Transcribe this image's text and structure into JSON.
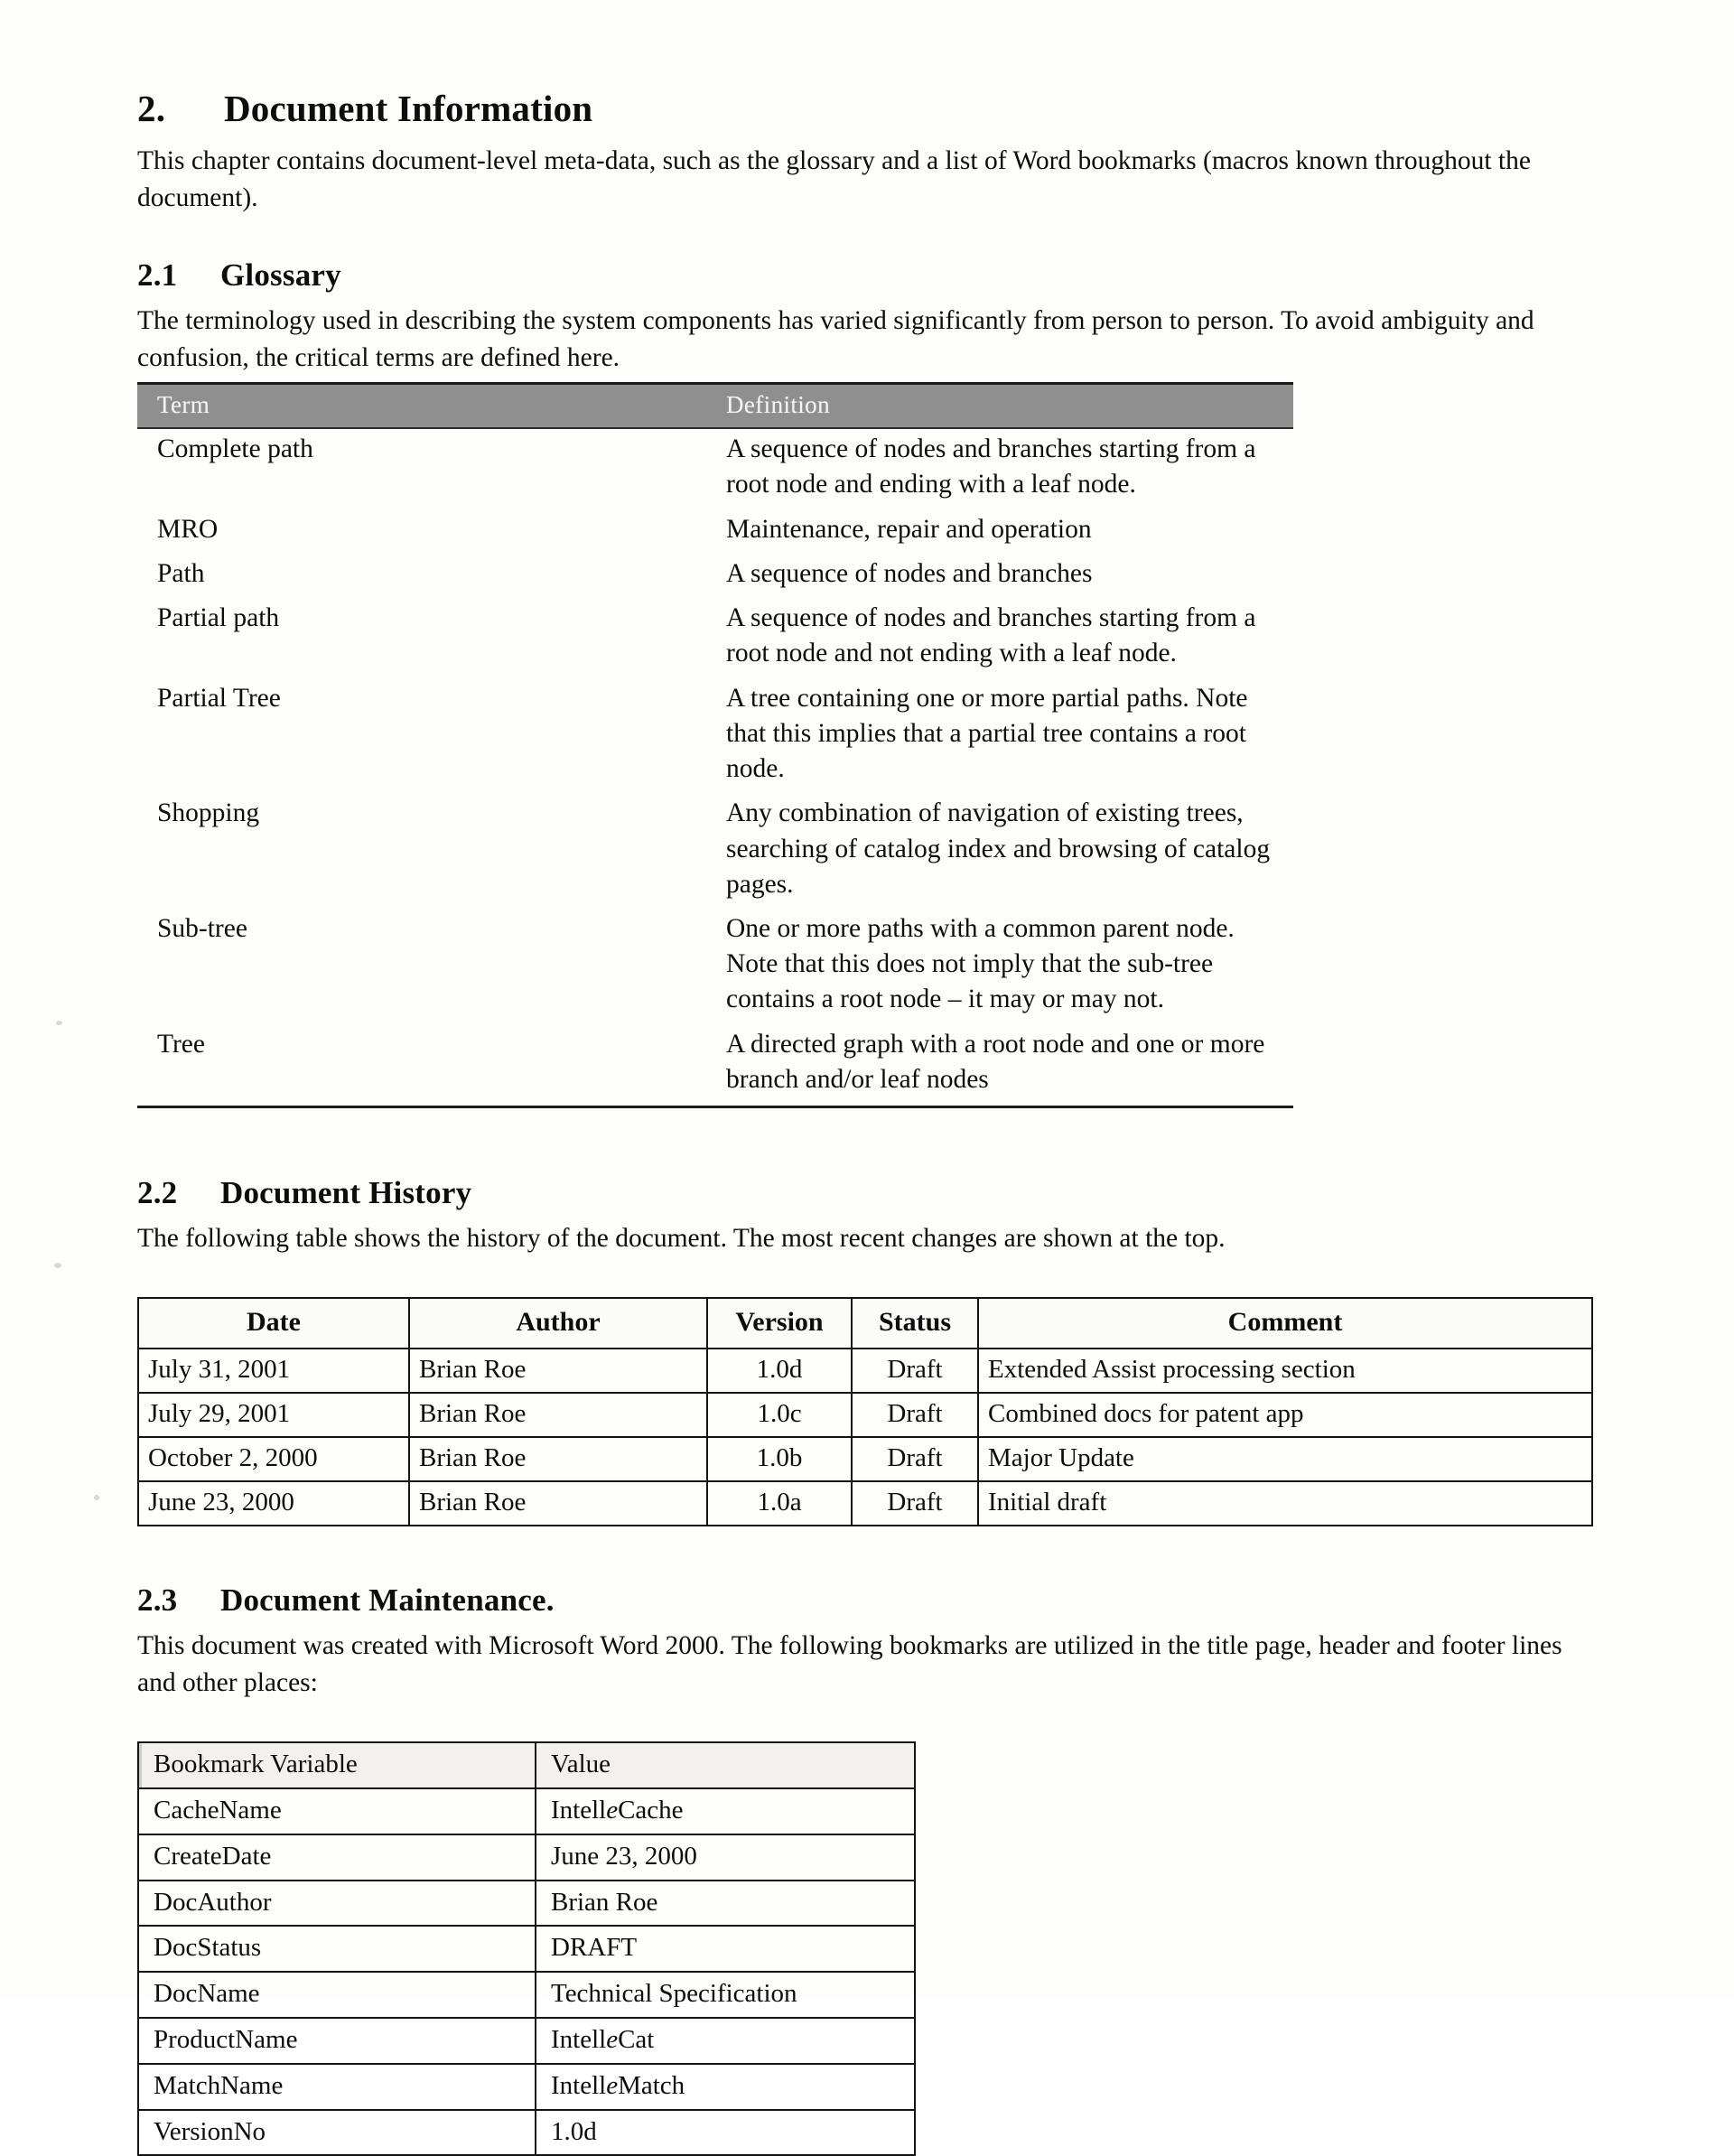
{
  "section": {
    "number": "2.",
    "title": "Document Information",
    "intro": "This chapter contains document-level meta-data, such as the glossary and a list of Word bookmarks (macros known throughout the document)."
  },
  "glossary": {
    "number": "2.1",
    "title": "Glossary",
    "intro": "The terminology used in describing the system components has varied significantly from person to person.  To avoid ambiguity and confusion, the critical terms are defined here.",
    "columns": [
      "Term",
      "Definition"
    ],
    "rows": [
      {
        "term": "Complete path",
        "definition": "A sequence of nodes and branches starting from a root node and ending with a leaf node."
      },
      {
        "term": "MRO",
        "definition": "Maintenance, repair and operation"
      },
      {
        "term": "Path",
        "definition": "A sequence of nodes and branches"
      },
      {
        "term": "Partial path",
        "definition": "A sequence of nodes and branches starting from a root node and not ending with a leaf node."
      },
      {
        "term": "Partial Tree",
        "definition": "A tree containing one or more partial paths.  Note that this implies that a partial tree contains a root node."
      },
      {
        "term": "Shopping",
        "definition": "Any combination of navigation of existing trees, searching of catalog index and browsing of catalog pages."
      },
      {
        "term": "Sub-tree",
        "definition": "One or more paths with a common parent node.  Note that this does not imply that the sub-tree contains a root node – it may or may not."
      },
      {
        "term": "Tree",
        "definition": "A directed graph with a root node and one or more branch and/or leaf nodes"
      }
    ]
  },
  "history": {
    "number": "2.2",
    "title": "Document History",
    "intro": "The following table shows the history of the document.  The most recent changes are shown at the top.",
    "columns": [
      "Date",
      "Author",
      "Version",
      "Status",
      "Comment"
    ],
    "rows": [
      {
        "date": "July 31, 2001",
        "author": "Brian Roe",
        "version": "1.0d",
        "status": "Draft",
        "comment": "Extended Assist processing section"
      },
      {
        "date": "July 29, 2001",
        "author": "Brian Roe",
        "version": "1.0c",
        "status": "Draft",
        "comment": "Combined docs for patent app"
      },
      {
        "date": "October 2, 2000",
        "author": "Brian Roe",
        "version": "1.0b",
        "status": "Draft",
        "comment": "Major Update"
      },
      {
        "date": "June 23, 2000",
        "author": "Brian Roe",
        "version": "1.0a",
        "status": "Draft",
        "comment": "Initial draft"
      }
    ]
  },
  "maintenance": {
    "number": "2.3",
    "title": "Document Maintenance.",
    "intro": "This document was created with Microsoft Word 2000. The following bookmarks are utilized in the title page, header and footer lines and other places:",
    "columns": [
      "Bookmark Variable",
      "Value"
    ],
    "rows": [
      {
        "variable": "CacheName",
        "value": "IntelleCache",
        "value_pre": "Intell",
        "value_ital": "e",
        "value_post": "Cache"
      },
      {
        "variable": "CreateDate",
        "value": "June 23, 2000",
        "value_pre": "June 23, 2000",
        "value_ital": "",
        "value_post": ""
      },
      {
        "variable": "DocAuthor",
        "value": "Brian Roe",
        "value_pre": "Brian Roe",
        "value_ital": "",
        "value_post": ""
      },
      {
        "variable": "DocStatus",
        "value": "DRAFT",
        "value_pre": "DRAFT",
        "value_ital": "",
        "value_post": ""
      },
      {
        "variable": "DocName",
        "value": "Technical Specification",
        "value_pre": "Technical Specification",
        "value_ital": "",
        "value_post": ""
      },
      {
        "variable": "ProductName",
        "value": "IntelleCat",
        "value_pre": "Intell",
        "value_ital": "e",
        "value_post": "Cat"
      },
      {
        "variable": "MatchName",
        "value": "IntelleMatch",
        "value_pre": "Intell",
        "value_ital": "e",
        "value_post": "Match"
      },
      {
        "variable": "VersionNo",
        "value": "1.0d",
        "value_pre": "1.0d",
        "value_ital": "",
        "value_post": ""
      }
    ]
  }
}
